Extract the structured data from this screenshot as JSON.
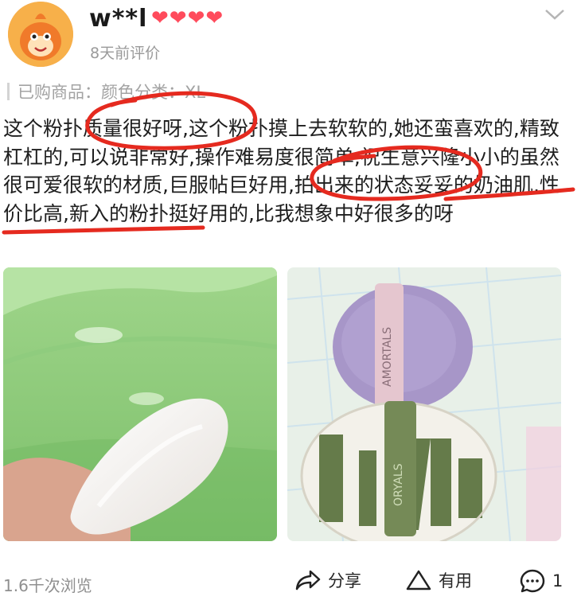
{
  "review": {
    "username": "w**l",
    "hearts": "❤❤❤❤",
    "time": "8天前评价",
    "product_label": "已购商品：颜色分类：XL",
    "text": "这个粉扑质量很好呀,这个粉扑摸上去软软的,她还蛮喜欢的,精致杠杠的,可以说非常好,操作难易度很简单,祝生意兴隆小小的虽然很可爱很软的材质,巨服帖巨好用,拍出来的状态妥妥的奶油肌,性价比高,新入的粉扑挺好用的,比我想象中好很多的呀"
  },
  "images": [
    {
      "icon": "photo-puff-in-hand"
    },
    {
      "icon": "photo-two-puffs",
      "strap_text_1": "AMORTALS",
      "strap_text_2": "ORYALS"
    }
  ],
  "footer": {
    "views": "1.6千次浏览",
    "share": "分享",
    "useful": "有用",
    "comments": "1"
  },
  "colors": {
    "accent_red": "#e52a1f",
    "heart": "#ff4b5c"
  }
}
